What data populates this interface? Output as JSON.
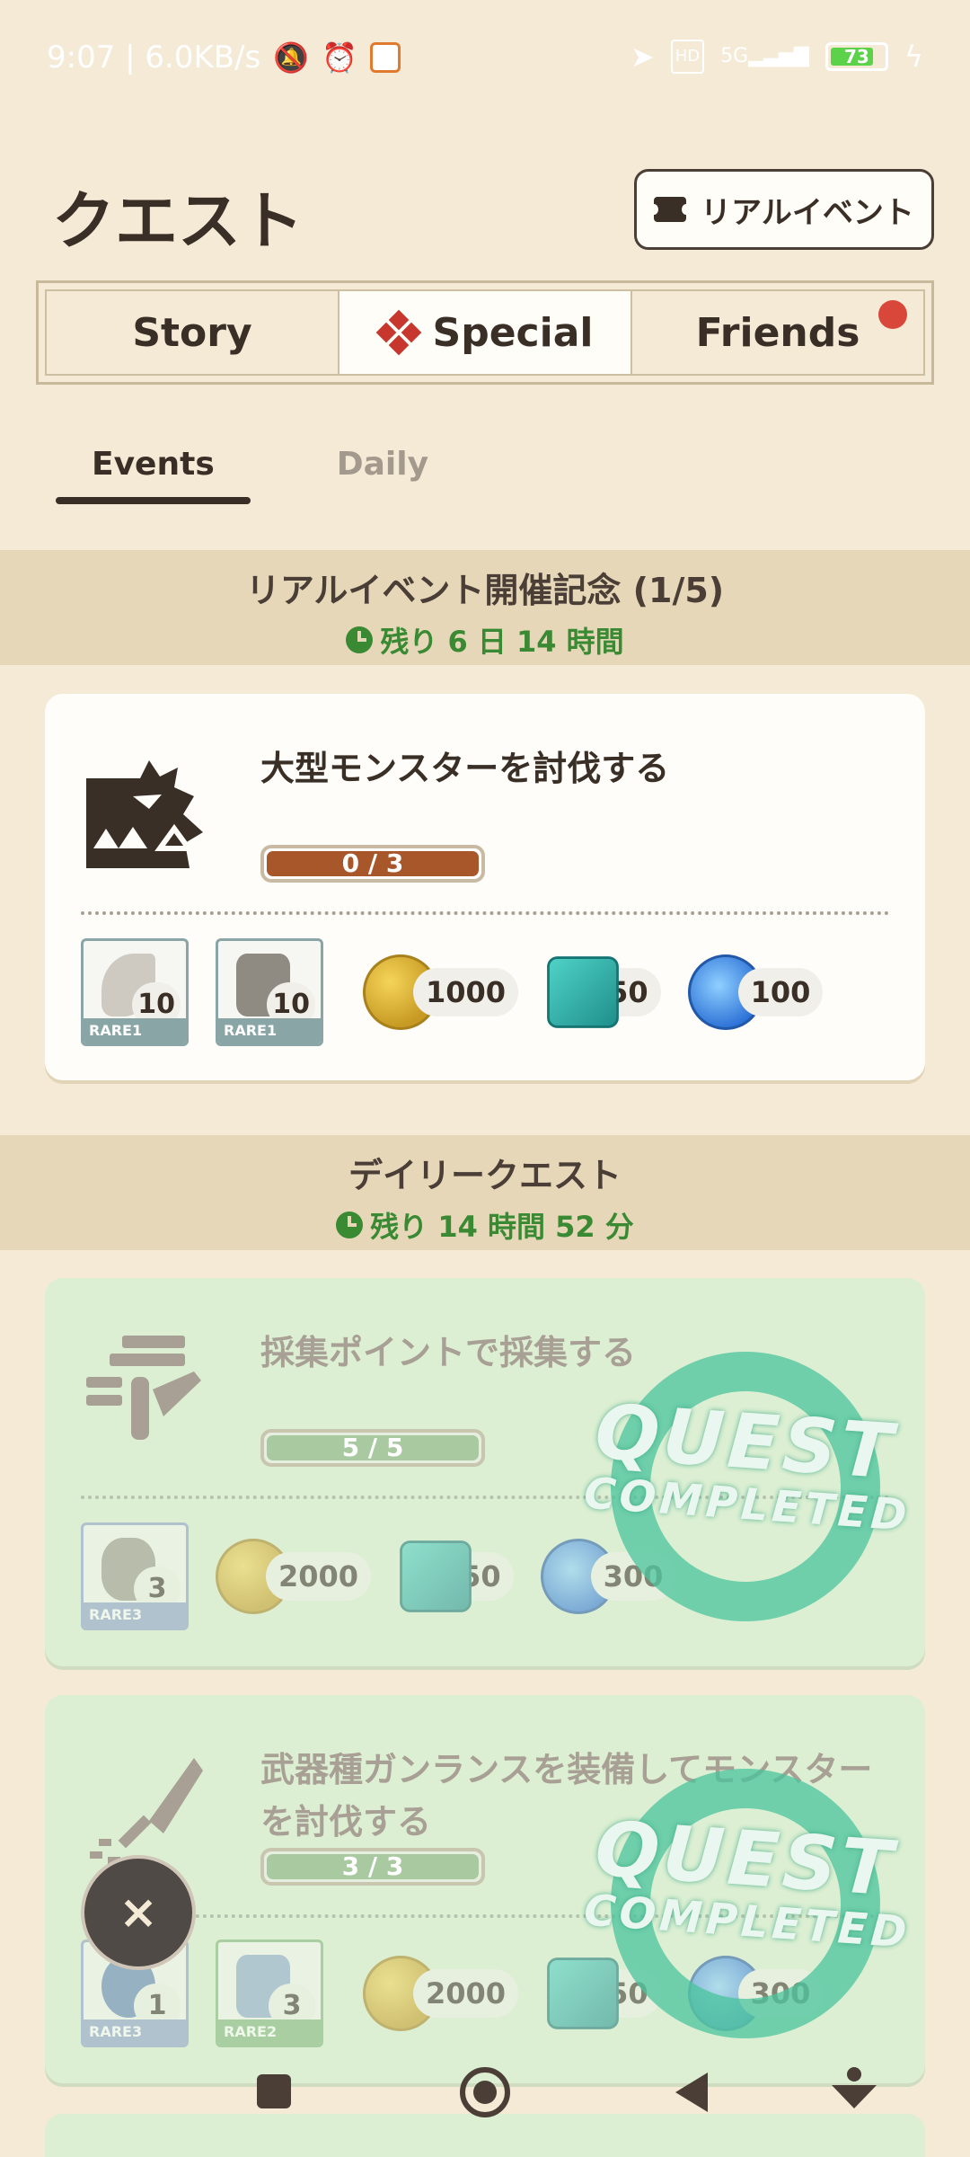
{
  "status_bar": {
    "time_speed": "9:07 | 6.0KB/s",
    "icons": [
      "mute-icon",
      "alarm-icon",
      "app-notification-icon",
      "location-icon",
      "volte-icon",
      "signal-5g-icon",
      "battery-icon",
      "charging-icon"
    ],
    "battery_level": "73"
  },
  "header": {
    "title": "クエスト",
    "real_event_button": "リアルイベント"
  },
  "main_tabs": [
    {
      "label": "Story",
      "active": false
    },
    {
      "label": "Special",
      "active": true
    },
    {
      "label": "Friends",
      "active": false,
      "has_notification": true
    }
  ],
  "sub_tabs": [
    {
      "label": "Events",
      "active": true
    },
    {
      "label": "Daily",
      "active": false
    }
  ],
  "sections": [
    {
      "title": "リアルイベント開催記念 (1/5)",
      "timer": "残り 6 日 14 時間",
      "quests": [
        {
          "title": "大型モンスターを討伐する",
          "progress": "0 / 3",
          "progress_fraction": 0,
          "completed": false,
          "items": [
            {
              "count": "10",
              "rarity": "RARE1"
            },
            {
              "count": "10",
              "rarity": "RARE1"
            }
          ],
          "currencies": [
            {
              "type": "gold-coin-icon",
              "amount": "1000"
            },
            {
              "type": "gem-icon",
              "amount": "50"
            },
            {
              "type": "blue-orb-icon",
              "amount": "100"
            }
          ]
        }
      ]
    },
    {
      "title": "デイリークエスト",
      "timer": "残り 14 時間 52 分",
      "quests": [
        {
          "title": "採集ポイントで採集する",
          "progress": "5 / 5",
          "progress_fraction": 1,
          "completed": true,
          "items": [
            {
              "count": "3",
              "rarity": "RARE3"
            }
          ],
          "currencies": [
            {
              "type": "gold-coin-icon",
              "amount": "2000"
            },
            {
              "type": "gem-icon",
              "amount": "50"
            },
            {
              "type": "blue-orb-icon",
              "amount": "300"
            }
          ]
        },
        {
          "title": "武器種ガンランスを装備してモンスターを討伐する",
          "progress": "3 / 3",
          "progress_fraction": 1,
          "completed": true,
          "items": [
            {
              "count": "1",
              "rarity": "RARE3"
            },
            {
              "count": "3",
              "rarity": "RARE2"
            }
          ],
          "currencies": [
            {
              "type": "gold-coin-icon",
              "amount": "2000"
            },
            {
              "type": "gem-icon",
              "amount": "50"
            },
            {
              "type": "blue-orb-icon",
              "amount": "300"
            }
          ]
        }
      ]
    }
  ],
  "stamp": {
    "line1": "QUEST",
    "line2": "COMPLETED"
  },
  "fab": {
    "close_label": "×"
  },
  "colors": {
    "background": "#f4ead6",
    "accent_red": "#c8372d",
    "timer_green": "#3a8a33",
    "progress_orange": "#a8572b",
    "completed_card": "#dcefd3",
    "stamp_teal": "#4ac49c"
  }
}
